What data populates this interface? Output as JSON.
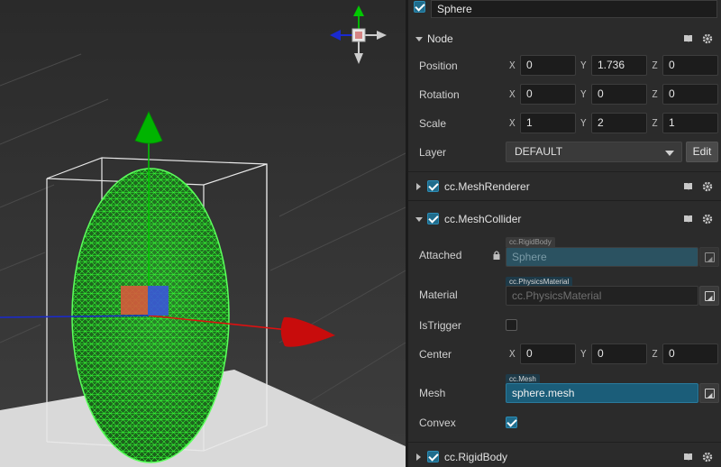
{
  "node": {
    "name": "Sphere",
    "active": true,
    "section_title": "Node",
    "position": {
      "label": "Position",
      "x": "0",
      "y": "1.736",
      "z": "0"
    },
    "rotation": {
      "label": "Rotation",
      "x": "0",
      "y": "0",
      "z": "0"
    },
    "scale": {
      "label": "Scale",
      "x": "1",
      "y": "2",
      "z": "1"
    },
    "layer": {
      "label": "Layer",
      "value": "DEFAULT",
      "edit_label": "Edit"
    }
  },
  "axis_letters": {
    "x": "X",
    "y": "Y",
    "z": "Z"
  },
  "components": {
    "mesh_renderer": {
      "title": "cc.MeshRenderer",
      "enabled": true,
      "expanded": false
    },
    "mesh_collider": {
      "title": "cc.MeshCollider",
      "enabled": true,
      "expanded": true,
      "attached": {
        "label": "Attached",
        "tag": "cc.RigidBody",
        "value": "Sphere"
      },
      "material": {
        "label": "Material",
        "tag": "cc.PhysicsMaterial",
        "placeholder": "cc.PhysicsMaterial"
      },
      "is_trigger": {
        "label": "IsTrigger",
        "checked": false
      },
      "center": {
        "label": "Center",
        "x": "0",
        "y": "0",
        "z": "0"
      },
      "mesh": {
        "label": "Mesh",
        "tag": "cc.Mesh",
        "value": "sphere.mesh"
      },
      "convex": {
        "label": "Convex",
        "checked": true
      }
    },
    "rigid_body": {
      "title": "cc.RigidBody",
      "enabled": true,
      "expanded": false
    }
  },
  "icons": {
    "help": "book-icon",
    "settings": "gear-icon",
    "lock": "lock-icon",
    "pick": "asset-picker-icon"
  },
  "colors": {
    "panel_bg": "#2b2b2b",
    "field_bg": "#1c1c1c",
    "accent": "#1f6c8c",
    "asset_bound_bg": "#1b5d79",
    "wireframe": "#00ff00",
    "axis_x": "#e01010",
    "axis_y": "#00c800",
    "axis_z": "#1030d0"
  }
}
